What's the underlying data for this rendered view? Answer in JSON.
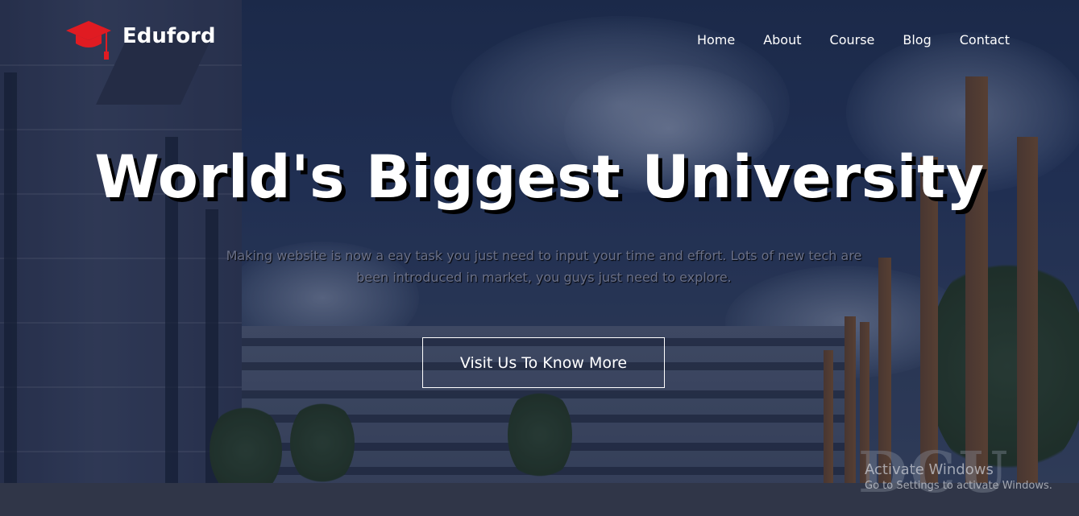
{
  "brand": {
    "name": "Eduford",
    "icon": "graduation-cap-icon",
    "icon_color": "#e01b22"
  },
  "nav": {
    "items": [
      {
        "label": "Home"
      },
      {
        "label": "About"
      },
      {
        "label": "Course"
      },
      {
        "label": "Blog"
      },
      {
        "label": "Contact"
      }
    ]
  },
  "hero": {
    "title": "World's Biggest University",
    "subtitle": "Making website is now a eay task you just need to input your time and effort. Lots of new tech are been introduced in market, you guys just need to explore.",
    "cta_label": "Visit Us To Know More",
    "sign_text": "DCU"
  },
  "watermark": {
    "title": "Activate Windows",
    "subtitle": "Go to Settings to activate Windows."
  },
  "colors": {
    "text": "#ffffff",
    "subtitle": "#6a7088",
    "accent": "#e01b22"
  }
}
